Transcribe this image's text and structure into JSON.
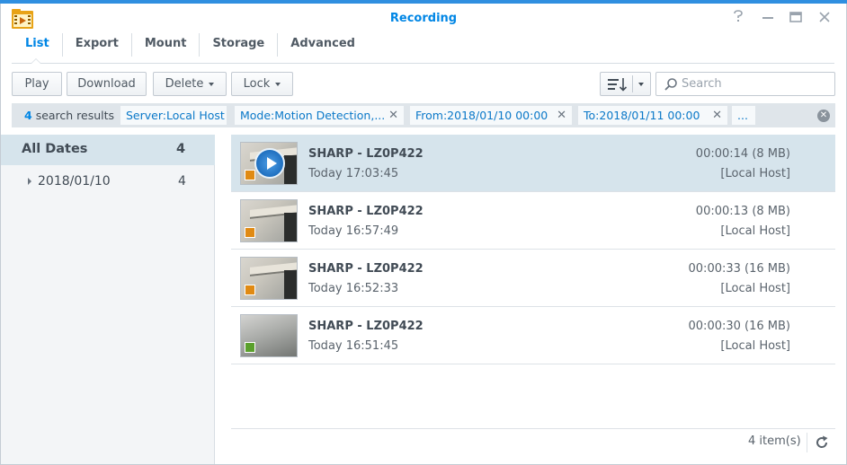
{
  "window": {
    "title": "Recording",
    "controls": [
      "help-icon",
      "minimize-icon",
      "maximize-icon",
      "close-icon"
    ]
  },
  "tabs": [
    {
      "label": "List",
      "active": true
    },
    {
      "label": "Export",
      "active": false
    },
    {
      "label": "Mount",
      "active": false
    },
    {
      "label": "Storage",
      "active": false
    },
    {
      "label": "Advanced",
      "active": false
    }
  ],
  "toolbar": {
    "play_label": "Play",
    "download_label": "Download",
    "delete_label": "Delete",
    "lock_label": "Lock",
    "search_placeholder": "Search"
  },
  "filters": {
    "result_count": "4",
    "result_suffix": "search results",
    "chips": [
      "Server:Local Host",
      "Mode:Motion Detection,...",
      "From:2018/01/10 00:00",
      "To:2018/01/11 00:00",
      "..."
    ]
  },
  "dates": {
    "all_label": "All Dates",
    "all_count": "4",
    "items": [
      {
        "label": "2018/01/10",
        "count": "4"
      }
    ]
  },
  "recordings": [
    {
      "camera": "SHARP - LZ0P422",
      "time": "Today 17:03:45",
      "duration": "00:00:14 (8 MB)",
      "server": "[Local Host]",
      "badge_color": "#e08a13",
      "selected": true
    },
    {
      "camera": "SHARP - LZ0P422",
      "time": "Today 16:57:49",
      "duration": "00:00:13 (8 MB)",
      "server": "[Local Host]",
      "badge_color": "#e08a13",
      "selected": false
    },
    {
      "camera": "SHARP - LZ0P422",
      "time": "Today 16:52:33",
      "duration": "00:00:33 (16 MB)",
      "server": "[Local Host]",
      "badge_color": "#e08a13",
      "selected": false
    },
    {
      "camera": "SHARP - LZ0P422",
      "time": "Today 16:51:45",
      "duration": "00:00:30 (16 MB)",
      "server": "[Local Host]",
      "badge_color": "#5aa02c",
      "selected": false
    }
  ],
  "footer": {
    "item_count": "4 item(s)"
  },
  "colors": {
    "accent": "#0086e5",
    "selected_row": "#d6e4ec",
    "filter_bar": "#dfe5ea"
  }
}
